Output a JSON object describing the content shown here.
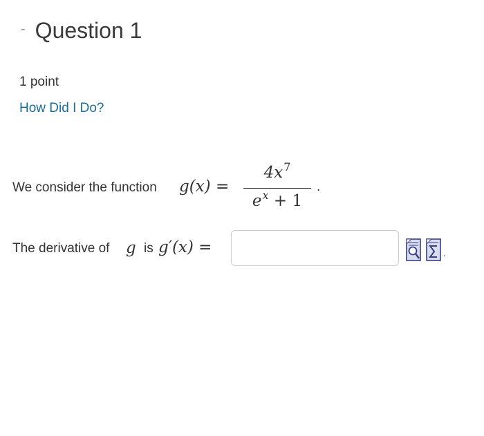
{
  "question": {
    "collapse_symbol": "-",
    "title": "Question 1",
    "points": "1 point",
    "feedback_link": "How Did I Do?"
  },
  "statement1": {
    "lead_text": "We consider the function",
    "lhs": "g(x) =",
    "numerator": "4x",
    "numerator_exponent": "7",
    "denominator_base": "e",
    "denominator_exponent": "x",
    "denominator_rest": "+ 1",
    "end_punct": "."
  },
  "statement2": {
    "lead_text": "The derivative of",
    "function_symbol": "g",
    "is_text": "is",
    "rhs": "g′(x) ="
  },
  "answer": {
    "value": "",
    "placeholder": ""
  },
  "tools": [
    {
      "name": "preview",
      "icon": "magnifier-document-icon"
    },
    {
      "name": "equation-editor",
      "icon": "sigma-document-icon"
    }
  ],
  "colors": {
    "link": "#1a6e96",
    "text": "#333333",
    "input_border": "#cccccc",
    "tool_icon": "#3a3f86"
  }
}
